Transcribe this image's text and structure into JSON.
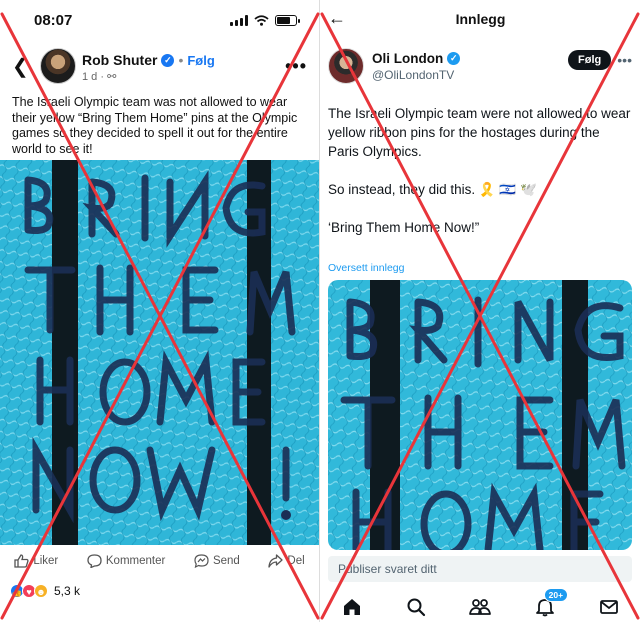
{
  "left": {
    "status": {
      "time": "08:07"
    },
    "post": {
      "author": "Rob Shuter",
      "follow_label": "Følg",
      "separator": "•",
      "meta": "1 d ·",
      "text": "The Israeli Olympic team was not allowed to wear their yellow “Bring Them Home” pins at the Olympic games so they decided to spell it out for the entire world to see it!"
    },
    "actions": {
      "like": "Liker",
      "comment": "Kommenter",
      "send": "Send",
      "share": "Del"
    },
    "reactions": {
      "count": "5,3 k"
    }
  },
  "right": {
    "header": {
      "title": "Innlegg"
    },
    "post": {
      "name": "Oli London",
      "handle": "@OliLondonTV",
      "follow_label": "Følg",
      "paragraphs": [
        "The Israeli Olympic team were not allowed to wear yellow ribbon pins for the hostages during the Paris Olympics.",
        "So instead, they did this. 🎗️ 🇮🇱 🕊️",
        "‘Bring Them Home Now!”"
      ],
      "translate": "Oversett innlegg"
    },
    "reply": {
      "placeholder": "Publiser svaret ditt"
    },
    "nav": {
      "badge": "20+"
    }
  },
  "colors": {
    "pool": "#2fb6d8",
    "lane": "#0e1a20",
    "cross": "#e8353a",
    "fb_blue": "#1877f2",
    "x_blue": "#1d9bf0"
  },
  "icons": [
    "back-chevron-icon",
    "more-icon",
    "like-icon",
    "comment-icon",
    "send-icon",
    "share-icon",
    "home-icon",
    "search-icon",
    "communities-icon",
    "notifications-icon",
    "messages-icon"
  ]
}
